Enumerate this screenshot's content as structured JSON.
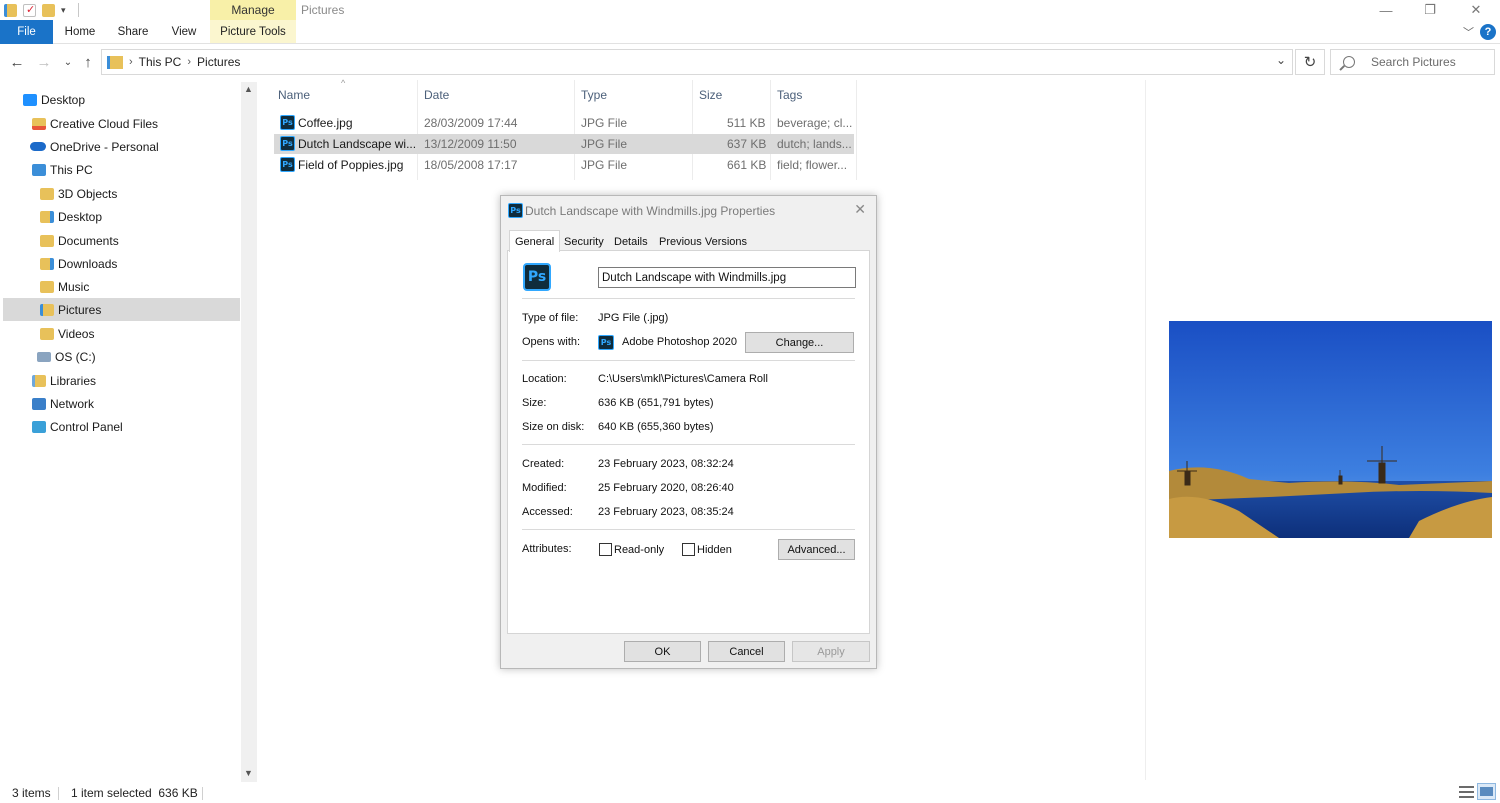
{
  "window": {
    "title": "Pictures",
    "contextual_tab": "Manage"
  },
  "ribbon": {
    "tabs": [
      {
        "label": "File"
      },
      {
        "label": "Home"
      },
      {
        "label": "Share"
      },
      {
        "label": "View"
      },
      {
        "label": "Picture Tools"
      }
    ]
  },
  "address": {
    "breadcrumbs": [
      "This PC",
      "Pictures"
    ]
  },
  "search": {
    "placeholder": "Search Pictures"
  },
  "navpane": {
    "items": [
      {
        "label": "Desktop",
        "icon": "desktop-icon",
        "color": "#1e90ff"
      },
      {
        "label": "Creative Cloud Files",
        "icon": "creative-cloud-icon",
        "color": "#e8553a"
      },
      {
        "label": "OneDrive - Personal",
        "icon": "onedrive-icon",
        "color": "#1b6ac9"
      },
      {
        "label": "This PC",
        "icon": "pc-icon",
        "color": "#3b8ed8"
      },
      {
        "label": "3D Objects",
        "icon": "folder-icon",
        "color": "#e8c15a"
      },
      {
        "label": "Desktop",
        "icon": "folder-icon",
        "color": "#e8c15a"
      },
      {
        "label": "Documents",
        "icon": "folder-icon",
        "color": "#e8c15a"
      },
      {
        "label": "Downloads",
        "icon": "folder-icon",
        "color": "#e8c15a"
      },
      {
        "label": "Music",
        "icon": "folder-icon",
        "color": "#e8c15a"
      },
      {
        "label": "Pictures",
        "icon": "folder-icon",
        "color": "#e8c15a"
      },
      {
        "label": "Videos",
        "icon": "folder-icon",
        "color": "#e8c15a"
      },
      {
        "label": "OS (C:)",
        "icon": "drive-icon",
        "color": "#8aa4c0"
      },
      {
        "label": "Libraries",
        "icon": "libraries-icon",
        "color": "#e8c15a"
      },
      {
        "label": "Network",
        "icon": "network-icon",
        "color": "#3a7fc9"
      },
      {
        "label": "Control Panel",
        "icon": "control-panel-icon",
        "color": "#3aa0d8"
      }
    ]
  },
  "filelist": {
    "columns": [
      "Name",
      "Date",
      "Type",
      "Size",
      "Tags"
    ],
    "rows": [
      {
        "name": "Coffee.jpg",
        "date": "28/03/2009 17:44",
        "type": "JPG File",
        "size": "511 KB",
        "tags": "beverage; cl..."
      },
      {
        "name": "Dutch Landscape wi...",
        "date": "13/12/2009 11:50",
        "type": "JPG File",
        "size": "637 KB",
        "tags": "dutch; lands..."
      },
      {
        "name": "Field of Poppies.jpg",
        "date": "18/05/2008 17:17",
        "type": "JPG File",
        "size": "661 KB",
        "tags": "field; flower..."
      }
    ],
    "selected_index": 1
  },
  "statusbar": {
    "item_count": "3 items",
    "selection": "1 item selected  636 KB"
  },
  "dialog": {
    "title": "Dutch Landscape with Windmills.jpg Properties",
    "tabs": [
      "General",
      "Security",
      "Details",
      "Previous Versions"
    ],
    "filename": "Dutch Landscape with Windmills.jpg",
    "type_label": "Type of file:",
    "type_value": "JPG File (.jpg)",
    "opens_label": "Opens with:",
    "opens_value": "Adobe Photoshop 2020",
    "change_button": "Change...",
    "location_label": "Location:",
    "location_value": "C:\\Users\\mkl\\Pictures\\Camera Roll",
    "size_label": "Size:",
    "size_value": "636 KB (651,791 bytes)",
    "size_on_disk_label": "Size on disk:",
    "size_on_disk_value": "640 KB (655,360 bytes)",
    "created_label": "Created:",
    "created_value": "23 February 2023, 08:32:24",
    "modified_label": "Modified:",
    "modified_value": "25 February 2020, 08:26:40",
    "accessed_label": "Accessed:",
    "accessed_value": "23 February 2023, 08:35:24",
    "attributes_label": "Attributes:",
    "readonly_label": "Read-only",
    "hidden_label": "Hidden",
    "advanced_button": "Advanced...",
    "ok_button": "OK",
    "cancel_button": "Cancel",
    "apply_button": "Apply",
    "icon_text": "Ps"
  },
  "colors": {
    "accent": "#1a73c8",
    "manage_tab": "#f8f0a8",
    "selection": "#d9d9d9",
    "photoshop_blue": "#31a8ff",
    "photoshop_dark": "#0f2c3c"
  }
}
